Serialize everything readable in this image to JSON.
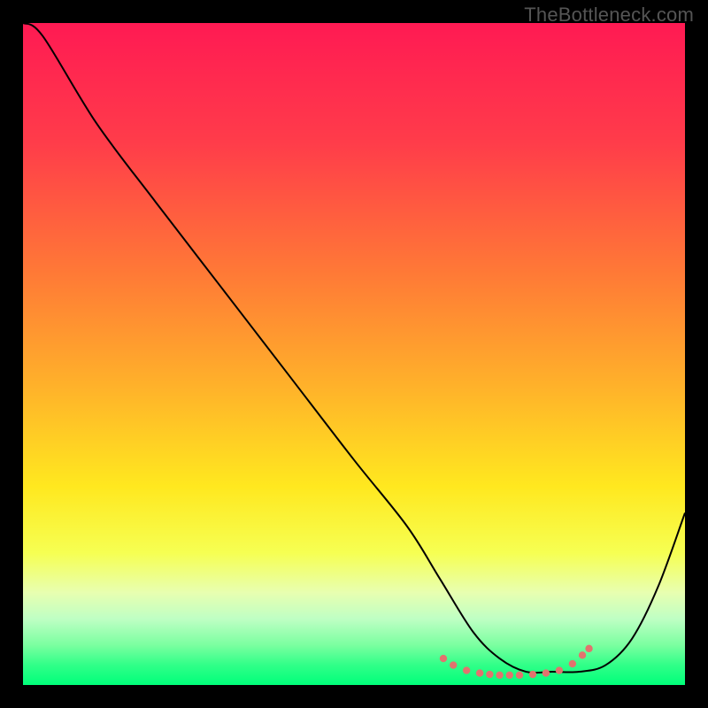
{
  "watermark": "TheBottleneck.com",
  "chart_data": {
    "type": "line",
    "title": "",
    "xlabel": "",
    "ylabel": "",
    "xlim": [
      0,
      100
    ],
    "ylim": [
      0,
      100
    ],
    "gradient_stops": [
      {
        "offset": 0,
        "color": "#ff1a53"
      },
      {
        "offset": 18,
        "color": "#ff3c4a"
      },
      {
        "offset": 38,
        "color": "#ff7a36"
      },
      {
        "offset": 55,
        "color": "#ffb22a"
      },
      {
        "offset": 70,
        "color": "#ffe81f"
      },
      {
        "offset": 80,
        "color": "#f6ff52"
      },
      {
        "offset": 86,
        "color": "#e8ffb0"
      },
      {
        "offset": 90,
        "color": "#bfffc4"
      },
      {
        "offset": 94,
        "color": "#7affa0"
      },
      {
        "offset": 97,
        "color": "#30ff88"
      },
      {
        "offset": 100,
        "color": "#00ff7a"
      }
    ],
    "series": [
      {
        "name": "bottleneck-curve",
        "color": "#000000",
        "x": [
          0,
          3,
          11,
          20,
          30,
          40,
          50,
          58,
          63,
          68,
          72,
          76,
          80,
          84,
          88,
          92,
          96,
          100
        ],
        "y": [
          100,
          98,
          85,
          73,
          60,
          47,
          34,
          24,
          16,
          8,
          4,
          2,
          2,
          2,
          3,
          7,
          15,
          26
        ]
      }
    ],
    "markers": {
      "name": "bottom-dots",
      "color": "#e2736e",
      "radius": 4.2,
      "x": [
        63.5,
        65,
        67,
        69,
        70.5,
        72,
        73.5,
        75,
        77,
        79,
        81,
        83,
        84.5,
        85.5
      ],
      "y": [
        4.0,
        3.0,
        2.2,
        1.8,
        1.6,
        1.5,
        1.5,
        1.5,
        1.6,
        1.8,
        2.2,
        3.2,
        4.5,
        5.5
      ]
    }
  }
}
